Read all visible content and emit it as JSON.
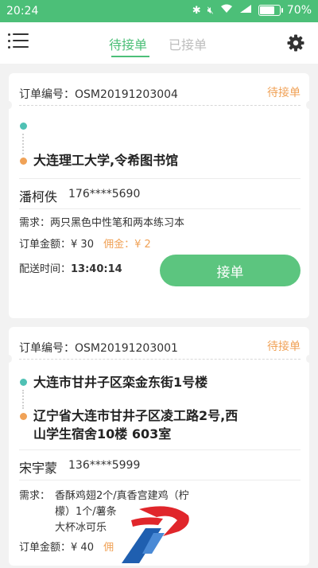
{
  "status_bar": {
    "time": "20:24",
    "battery": "70%"
  },
  "header": {
    "tabs": [
      {
        "label": "待接单",
        "active": true
      },
      {
        "label": "已接单",
        "active": false
      }
    ]
  },
  "orders": [
    {
      "order_label": "订单编号：",
      "order_no": "OSM20191203004",
      "status": "待接单",
      "pickup": "",
      "destination": "大连理工大学,令希图书馆",
      "customer_name": "潘柯佚",
      "customer_phone": "176****5690",
      "need_label": "需求：",
      "need": "两只黑色中性笔和两本练习本",
      "amount_label": "订单金额：",
      "amount": "¥ 30",
      "commission_label": "佣金：",
      "commission": "¥ 2",
      "delivery_label": "配送时间：",
      "delivery_time": "13:40:14",
      "accept_label": "接单"
    },
    {
      "order_label": "订单编号：",
      "order_no": "OSM20191203001",
      "status": "待接单",
      "pickup": "大连市甘井子区栾金东街1号楼",
      "destination_line1": "辽宁省大连市甘井子区凌工路2号,西",
      "destination_line2": "山学生宿舍10楼 603室",
      "customer_name": "宋宇蒙",
      "customer_phone": "136****5999",
      "need_label": "需求：",
      "need_line1": "香酥鸡翅2个/真香宫建鸡（柠",
      "need_line2": "檬）1个/薯条",
      "need_line3": "大杯冰可乐",
      "amount_label": "订单金额：",
      "amount": "¥ 40",
      "commission_label": "佣",
      "commission": ""
    }
  ],
  "colors": {
    "primary": "#4cbf78",
    "accent": "#f0a257",
    "teal_dot": "#4fc1b4"
  }
}
